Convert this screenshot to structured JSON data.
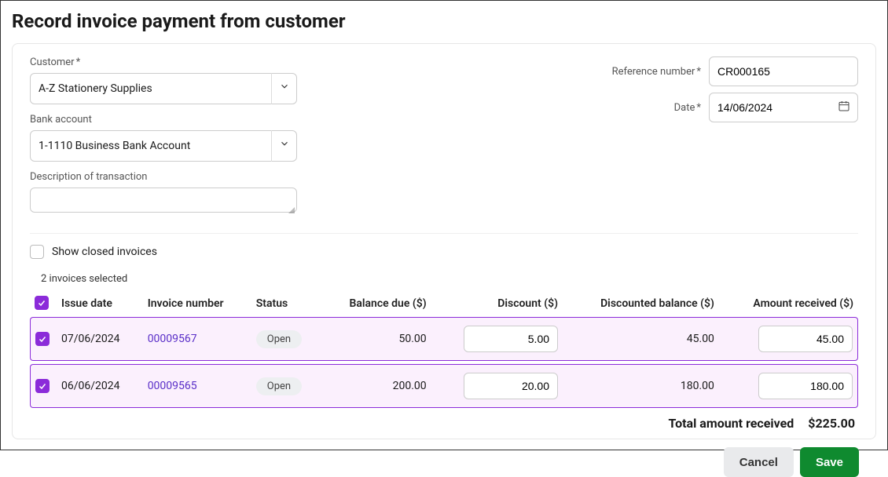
{
  "page_title": "Record invoice payment from customer",
  "labels": {
    "customer": "Customer",
    "bank_account": "Bank account",
    "description": "Description of transaction",
    "reference": "Reference number",
    "date": "Date",
    "show_closed": "Show closed invoices",
    "selected_count": "2 invoices selected",
    "cancel": "Cancel",
    "save": "Save"
  },
  "fields": {
    "customer": "A-Z Stationery Supplies",
    "bank_account": "1-1110  Business Bank Account",
    "description": "",
    "reference": "CR000165",
    "date": "14/06/2024",
    "show_closed_checked": false
  },
  "table": {
    "headers": {
      "issue_date": "Issue date",
      "invoice_number": "Invoice number",
      "status": "Status",
      "balance_due": "Balance due ($)",
      "discount": "Discount ($)",
      "discounted_balance": "Discounted balance ($)",
      "amount_received": "Amount received ($)"
    },
    "rows": [
      {
        "checked": true,
        "issue_date": "07/06/2024",
        "invoice_number": "00009567",
        "status": "Open",
        "balance_due": "50.00",
        "discount": "5.00",
        "discounted_balance": "45.00",
        "amount_received": "45.00"
      },
      {
        "checked": true,
        "issue_date": "06/06/2024",
        "invoice_number": "00009565",
        "status": "Open",
        "balance_due": "200.00",
        "discount": "20.00",
        "discounted_balance": "180.00",
        "amount_received": "180.00"
      }
    ]
  },
  "totals": {
    "label": "Total amount received",
    "amount": "$225.00"
  }
}
